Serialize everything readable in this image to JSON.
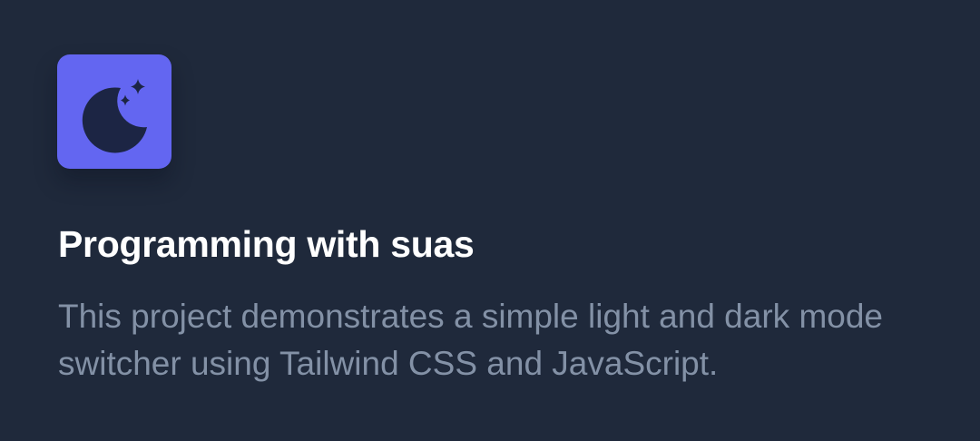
{
  "card": {
    "icon": "moon-stars-icon",
    "title": "Programming with suas",
    "description": "This project demonstrates a simple light and dark mode switcher using Tailwind CSS and JavaScript."
  },
  "colors": {
    "background": "#1f293b",
    "icon_tile": "#6366f1",
    "icon_glyph": "#1c2544",
    "title": "#ffffff",
    "description": "#8391a6"
  }
}
